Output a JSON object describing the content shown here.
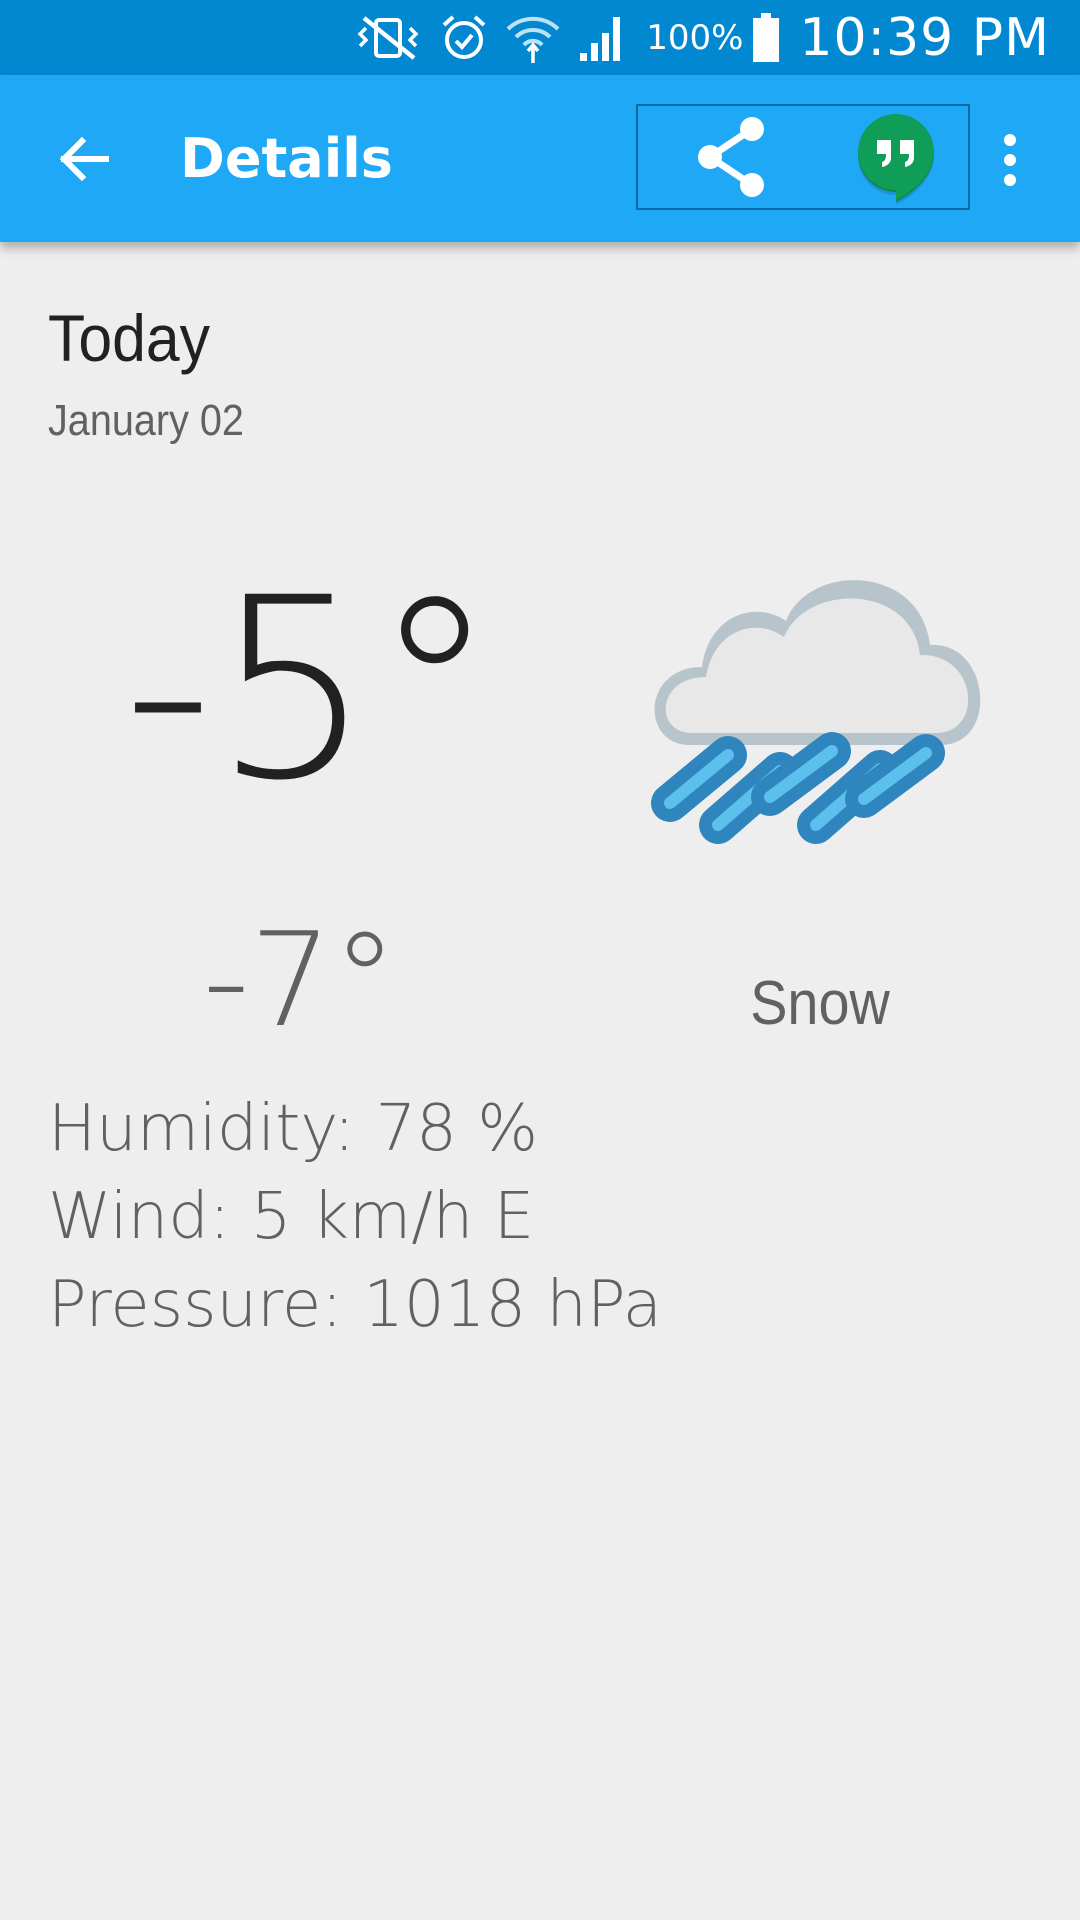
{
  "status_bar": {
    "battery_percent": "100%",
    "time": "10:39 PM",
    "icons": [
      "vibrate-off-icon",
      "alarm-icon",
      "wifi-icon",
      "signal-icon",
      "battery-icon"
    ]
  },
  "app_bar": {
    "title": "Details",
    "back_icon": "arrow-left-icon",
    "share_icon": "share-icon",
    "hangouts_icon": "hangouts-icon",
    "overflow_icon": "more-vert-icon"
  },
  "forecast": {
    "day": "Today",
    "date": "January 02",
    "high": "-5°",
    "low": "-7°",
    "condition": "Snow",
    "condition_icon": "snow-icon",
    "humidity": "Humidity: 78 %",
    "wind": "Wind: 5 km/h E",
    "pressure": "Pressure: 1018 hPa"
  },
  "colors": {
    "status_bar": "#0288d1",
    "app_bar": "#1fa8f5",
    "background": "#eeeeee",
    "hangouts_green": "#0f9d58"
  }
}
